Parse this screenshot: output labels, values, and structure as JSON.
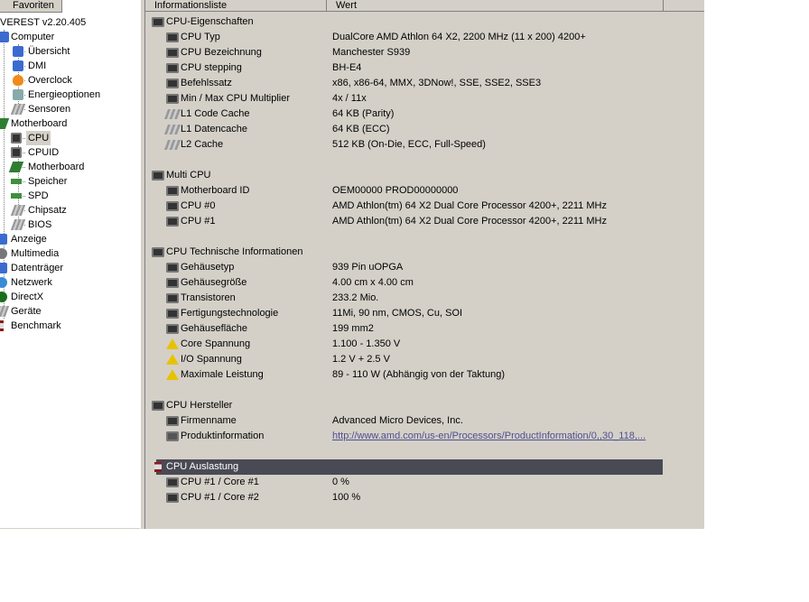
{
  "left_panel": {
    "tab_label": "Favoriten",
    "root_label": "VEREST v2.20.405",
    "nodes": [
      {
        "label": "Computer",
        "icon": "computer-icon"
      },
      {
        "label": "Übersicht",
        "icon": "info-icon"
      },
      {
        "label": "DMI",
        "icon": "info-icon"
      },
      {
        "label": "Overclock",
        "icon": "flame-icon"
      },
      {
        "label": "Energieoptionen",
        "icon": "power-icon"
      },
      {
        "label": "Sensoren",
        "icon": "sensor-icon"
      },
      {
        "label": "Motherboard",
        "icon": "motherboard-icon"
      },
      {
        "label": "CPU",
        "icon": "cpu-icon"
      },
      {
        "label": "CPUID",
        "icon": "cpu-icon"
      },
      {
        "label": "Motherboard",
        "icon": "motherboard-icon"
      },
      {
        "label": "Speicher",
        "icon": "memory-icon"
      },
      {
        "label": "SPD",
        "icon": "memory-icon"
      },
      {
        "label": "Chipsatz",
        "icon": "chipset-icon"
      },
      {
        "label": "BIOS",
        "icon": "chipset-icon"
      },
      {
        "label": "Anzeige",
        "icon": "display-icon"
      },
      {
        "label": "Multimedia",
        "icon": "multimedia-icon"
      },
      {
        "label": "Datenträger",
        "icon": "disk-icon"
      },
      {
        "label": "Netzwerk",
        "icon": "network-icon"
      },
      {
        "label": "DirectX",
        "icon": "directx-icon"
      },
      {
        "label": "Geräte",
        "icon": "devices-icon"
      },
      {
        "label": "Benchmark",
        "icon": "benchmark-icon"
      }
    ]
  },
  "columns": {
    "field": "Informationsliste",
    "value": "Wert"
  },
  "sections": {
    "cpu_props": {
      "title": "CPU-Eigenschaften",
      "rows": [
        {
          "field": "CPU Typ",
          "value": "DualCore AMD Athlon 64 X2, 2200 MHz (11 x 200) 4200+"
        },
        {
          "field": "CPU Bezeichnung",
          "value": "Manchester S939"
        },
        {
          "field": "CPU stepping",
          "value": "BH-E4"
        },
        {
          "field": "Befehlssatz",
          "value": "x86, x86-64, MMX, 3DNow!, SSE, SSE2, SSE3"
        },
        {
          "field": "Min / Max CPU Multiplier",
          "value": "4x / 11x"
        },
        {
          "field": "L1 Code Cache",
          "value": "64 KB  (Parity)"
        },
        {
          "field": "L1 Datencache",
          "value": "64 KB  (ECC)"
        },
        {
          "field": "L2 Cache",
          "value": "512 KB  (On-Die, ECC, Full-Speed)"
        }
      ]
    },
    "multi_cpu": {
      "title": "Multi CPU",
      "rows": [
        {
          "field": "Motherboard ID",
          "value": "OEM00000 PROD00000000"
        },
        {
          "field": "CPU #0",
          "value": "AMD Athlon(tm) 64 X2 Dual Core Processor 4200+, 2211 MHz"
        },
        {
          "field": "CPU #1",
          "value": "AMD Athlon(tm) 64 X2 Dual Core Processor 4200+, 2211 MHz"
        }
      ]
    },
    "tech_info": {
      "title": "CPU Technische Informationen",
      "rows": [
        {
          "field": "Gehäusetyp",
          "value": "939 Pin uOPGA"
        },
        {
          "field": "Gehäusegröße",
          "value": "4.00 cm x 4.00 cm"
        },
        {
          "field": "Transistoren",
          "value": "233.2 Mio."
        },
        {
          "field": "Fertigungstechnologie",
          "value": "11Mi, 90 nm, CMOS, Cu, SOI"
        },
        {
          "field": "Gehäusefläche",
          "value": "199 mm2"
        },
        {
          "field": "Core Spannung",
          "value": "1.100 - 1.350 V"
        },
        {
          "field": "I/O Spannung",
          "value": "1.2 V + 2.5 V"
        },
        {
          "field": "Maximale Leistung",
          "value": "89 - 110 W  (Abhängig von der Taktung)"
        }
      ]
    },
    "manufacturer": {
      "title": "CPU Hersteller",
      "rows": [
        {
          "field": "Firmenname",
          "value": "Advanced Micro Devices, Inc."
        },
        {
          "field": "Produktinformation",
          "value": "http://www.amd.com/us-en/Processors/ProductInformation/0,,30_118,..."
        }
      ]
    },
    "load": {
      "title": "CPU Auslastung",
      "rows": [
        {
          "field": "CPU #1 / Core #1",
          "value": "0 %"
        },
        {
          "field": "CPU #1 / Core #2",
          "value": "100 %"
        }
      ]
    }
  }
}
